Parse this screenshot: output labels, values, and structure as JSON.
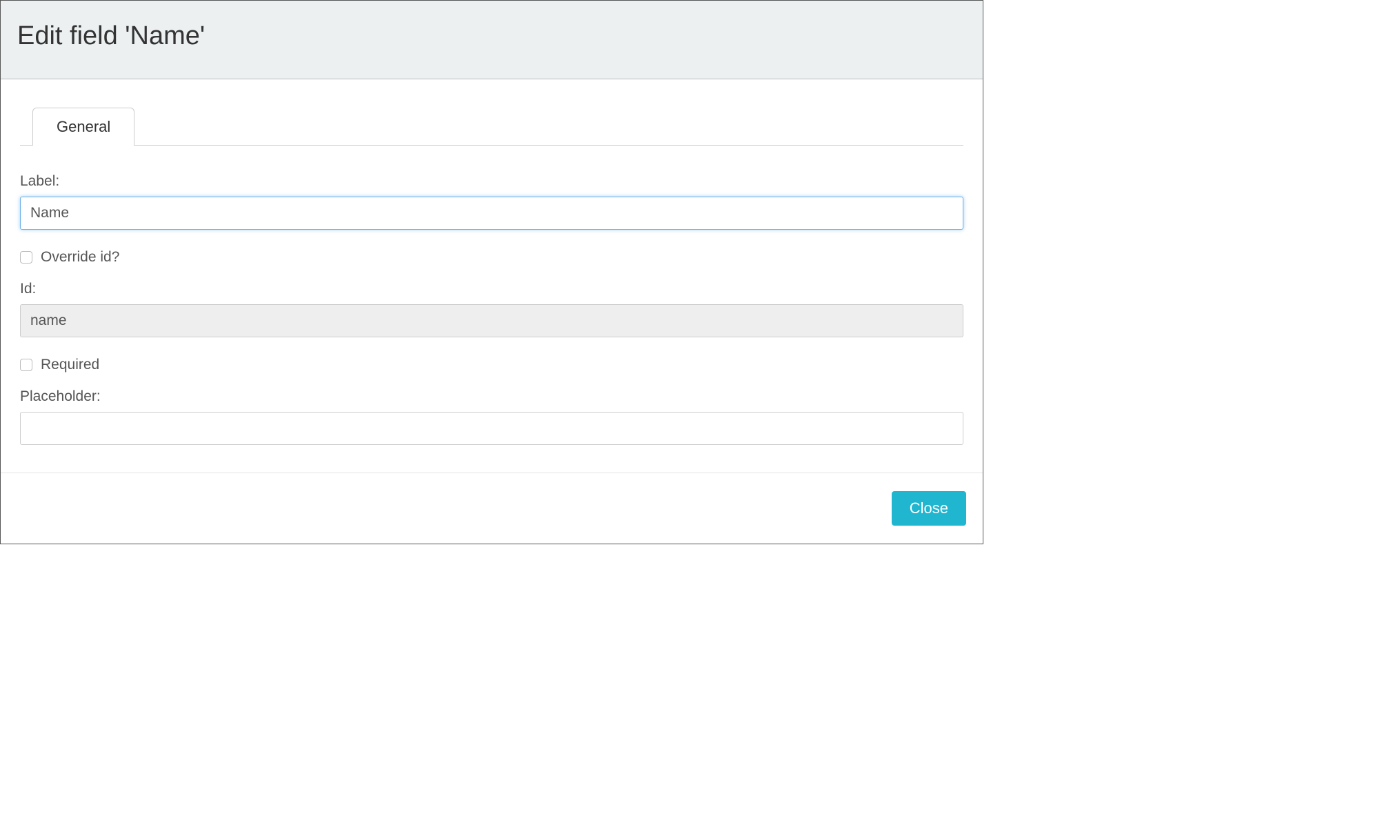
{
  "modal": {
    "title": "Edit field 'Name'"
  },
  "tabs": {
    "general": "General"
  },
  "form": {
    "label_field": {
      "label": "Label:",
      "value": "Name"
    },
    "override_id": {
      "label": "Override id?",
      "checked": false
    },
    "id_field": {
      "label": "Id:",
      "value": "name"
    },
    "required": {
      "label": "Required",
      "checked": false
    },
    "placeholder_field": {
      "label": "Placeholder:",
      "value": ""
    }
  },
  "footer": {
    "close_label": "Close"
  }
}
